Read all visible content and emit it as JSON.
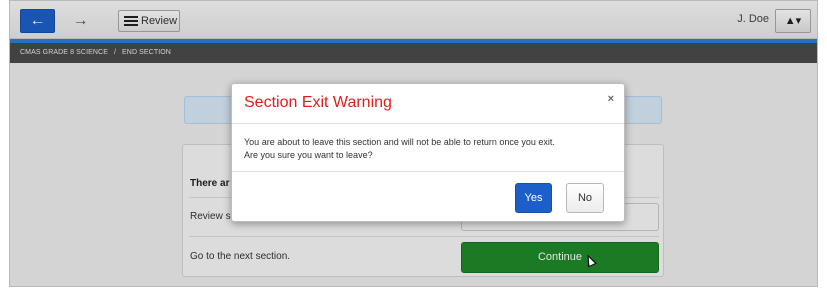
{
  "toolbar": {
    "back_icon": "arrow-left-icon",
    "back_symbol": "←",
    "forward_icon": "arrow-right-icon",
    "forward_symbol": "→",
    "review_label": "Review",
    "review_icon": "list-icon",
    "user_name": "J. Doe",
    "user_icon": "user-icon",
    "user_symbol": "▲▾"
  },
  "breadcrumb": {
    "course": "CMAS GRADE 8 SCIENCE",
    "separator": "/",
    "section": "END SECTION"
  },
  "panel": {
    "heading_partial": "There ar",
    "review_partial": "Review se",
    "next_label": "Go to the next section.",
    "continue_label": "Continue"
  },
  "modal": {
    "title": "Section Exit Warning",
    "close_symbol": "×",
    "line1": "You are about to leave this section and will not be able to return once you exit.",
    "line2": "Are you sure you want to leave?",
    "yes_label": "Yes",
    "no_label": "No"
  },
  "colors": {
    "primary_blue": "#1d5fc9",
    "continue_green": "#1f8a2a",
    "warning_red": "#e21b1b",
    "breadcrumb_bg": "#4a4a4a"
  }
}
